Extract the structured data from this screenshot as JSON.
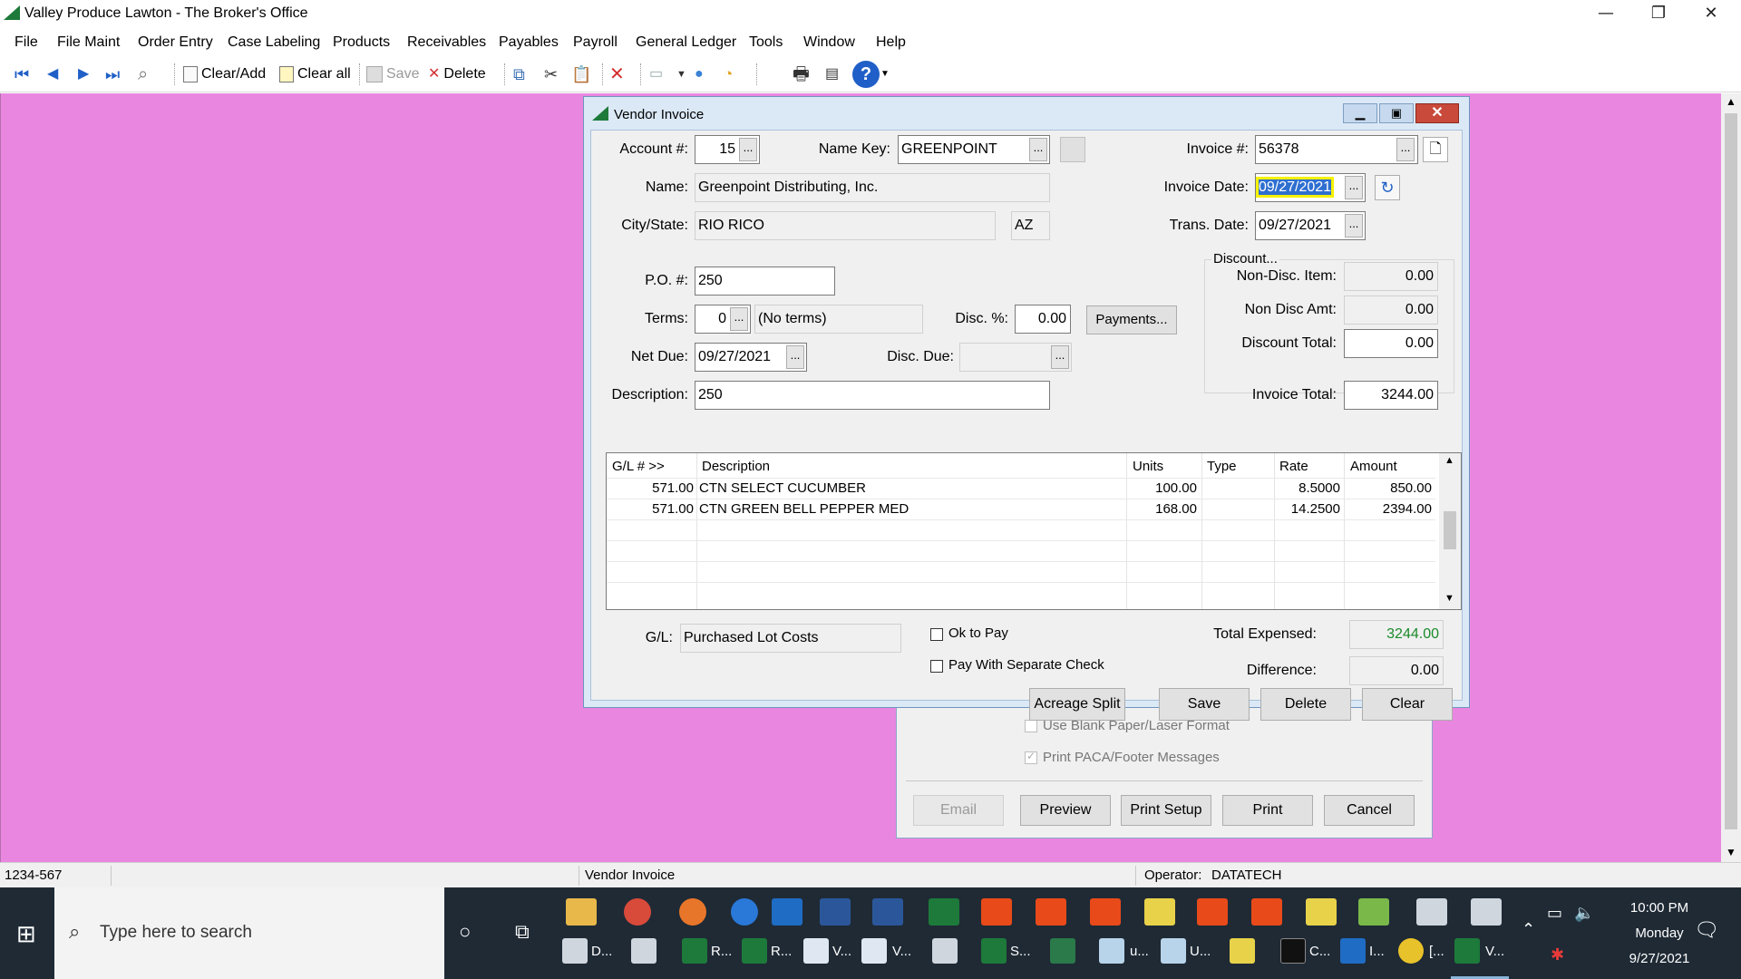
{
  "app": {
    "title": "Valley Produce Lawton - The Broker's Office",
    "window_controls": {
      "minimize": "—",
      "restore": "❐",
      "close": "✕"
    }
  },
  "menu": [
    "File",
    "File Maint",
    "Order Entry",
    "Case Labeling",
    "Products",
    "Receivables",
    "Payables",
    "Payroll",
    "General Ledger",
    "Tools",
    "Window",
    "Help"
  ],
  "toolbar": {
    "clear_add": "Clear/Add",
    "clear_all": "Clear all",
    "save": "Save",
    "delete": "Delete"
  },
  "vendor_invoice": {
    "title": "Vendor Invoice",
    "labels": {
      "account": "Account #:",
      "name_key": "Name Key:",
      "invoice_no": "Invoice #:",
      "name": "Name:",
      "invoice_date": "Invoice Date:",
      "city_state": "City/State:",
      "trans_date": "Trans. Date:",
      "po": "P.O. #:",
      "terms": "Terms:",
      "disc_pct": "Disc. %:",
      "net_due": "Net Due:",
      "disc_due": "Disc. Due:",
      "description": "Description:",
      "discount_group": "Discount...",
      "non_disc_item": "Non-Disc. Item:",
      "non_disc_amt": "Non Disc Amt:",
      "discount_total": "Discount Total:",
      "invoice_total": "Invoice Total:",
      "gl": "G/L:",
      "total_expensed": "Total Expensed:",
      "difference": "Difference:"
    },
    "values": {
      "account": "15",
      "name_key": "GREENPOINT",
      "invoice_no": "56378",
      "name": "Greenpoint Distributing, Inc.",
      "invoice_date": "09/27/2021",
      "city": "RIO RICO",
      "state": "AZ",
      "trans_date": "09/27/2021",
      "po": "250",
      "terms_code": "0",
      "terms_text": "(No terms)",
      "disc_pct": "0.00",
      "net_due": "09/27/2021",
      "disc_due": "",
      "description": "250",
      "non_disc_item": "0.00",
      "non_disc_amt": "0.00",
      "discount_total": "0.00",
      "invoice_total": "3244.00",
      "gl_account": "Purchased Lot Costs",
      "total_expensed": "3244.00",
      "difference": "0.00"
    },
    "payments_button": "Payments...",
    "ellipsis": "...",
    "grid": {
      "columns": [
        "G/L # >>",
        "Description",
        "Units",
        "Type",
        "Rate",
        "Amount"
      ],
      "rows": [
        {
          "gl": "571.00",
          "description": "CTN SELECT CUCUMBER",
          "units": "100.00",
          "type": "",
          "rate": "8.5000",
          "amount": "850.00"
        },
        {
          "gl": "571.00",
          "description": "CTN GREEN BELL PEPPER MED",
          "units": "168.00",
          "type": "",
          "rate": "14.2500",
          "amount": "2394.00"
        }
      ]
    },
    "checkboxes": {
      "ok_to_pay": "Ok to Pay",
      "separate_check": "Pay With Separate Check"
    },
    "buttons": {
      "acreage_split": "Acreage Split",
      "save": "Save",
      "delete": "Delete",
      "clear": "Clear"
    }
  },
  "print_dialog": {
    "use_blank_paper": "Use Blank Paper/Laser Format",
    "print_paca": "Print PACA/Footer Messages",
    "buttons": {
      "email": "Email",
      "preview": "Preview",
      "print_setup": "Print Setup",
      "print": "Print",
      "cancel": "Cancel"
    }
  },
  "status_bar": {
    "left": "1234-567",
    "window": "Vendor Invoice",
    "operator_label": "Operator:",
    "operator": "DATATECH"
  },
  "taskbar": {
    "search_placeholder": "Type here to search",
    "row2_labels": [
      "D...",
      "R...",
      "R...",
      "V...",
      "V...",
      "S...",
      "u...",
      "U...",
      "C...",
      "I...",
      "[...",
      "V..."
    ],
    "clock_time": "10:00 PM",
    "clock_day": "Monday",
    "clock_date": "9/27/2021"
  }
}
